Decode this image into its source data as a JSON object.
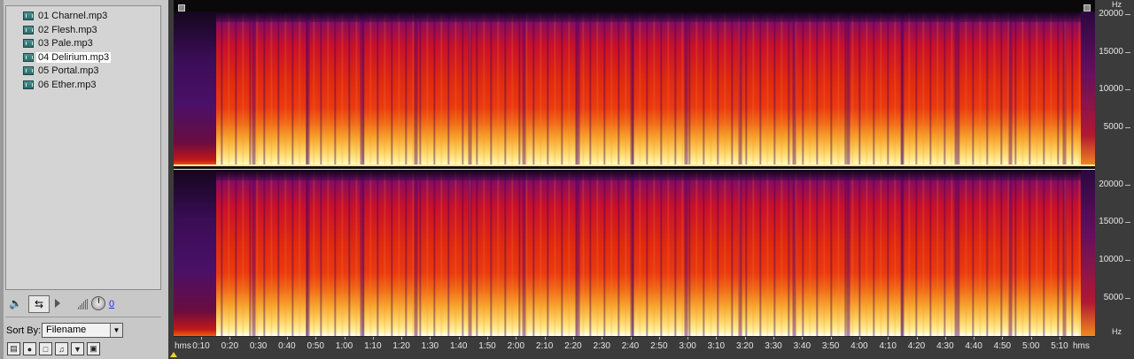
{
  "files": [
    {
      "name": "01 Charnel.mp3",
      "selected": false
    },
    {
      "name": "02 Flesh.mp3",
      "selected": false
    },
    {
      "name": "03 Pale.mp3",
      "selected": false
    },
    {
      "name": "04 Delirium.mp3",
      "selected": true
    },
    {
      "name": "05 Portal.mp3",
      "selected": false
    },
    {
      "name": "06 Ether.mp3",
      "selected": false
    }
  ],
  "transport": {
    "volume_value": "0",
    "speaker_icon": "speaker-icon",
    "loop_icon": "loop-icon",
    "play_icon": "play-icon"
  },
  "sort": {
    "label": "Sort By:",
    "value": "Filename"
  },
  "bottom_buttons": [
    "insert-icon",
    "stop-icon",
    "record-icon",
    "music-icon",
    "filter-icon",
    "tag-icon"
  ],
  "hz_ruler": {
    "unit_top": "Hz",
    "unit_bottom": "Hz",
    "ch1_labels": [
      "20000",
      "15000",
      "10000",
      "5000"
    ],
    "ch2_labels": [
      "20000",
      "15000",
      "10000",
      "5000"
    ]
  },
  "time_ruler": {
    "unit_left": "hms",
    "unit_right": "hms",
    "labels": [
      "0:10",
      "0:20",
      "0:30",
      "0:40",
      "0:50",
      "1:00",
      "1:10",
      "1:20",
      "1:30",
      "1:40",
      "1:50",
      "2:00",
      "2:10",
      "2:20",
      "2:30",
      "2:40",
      "2:50",
      "3:00",
      "3:10",
      "3:20",
      "3:30",
      "3:40",
      "3:50",
      "4:00",
      "4:10",
      "4:20",
      "4:30",
      "4:40",
      "4:50",
      "5:00",
      "5:10"
    ]
  },
  "colors": {
    "spectrum_low": "#5a0a6a",
    "spectrum_mid": "#e02a10",
    "spectrum_high": "#fff2a0",
    "panel_bg": "#c8c8c8",
    "view_bg": "#3b3b3b"
  }
}
